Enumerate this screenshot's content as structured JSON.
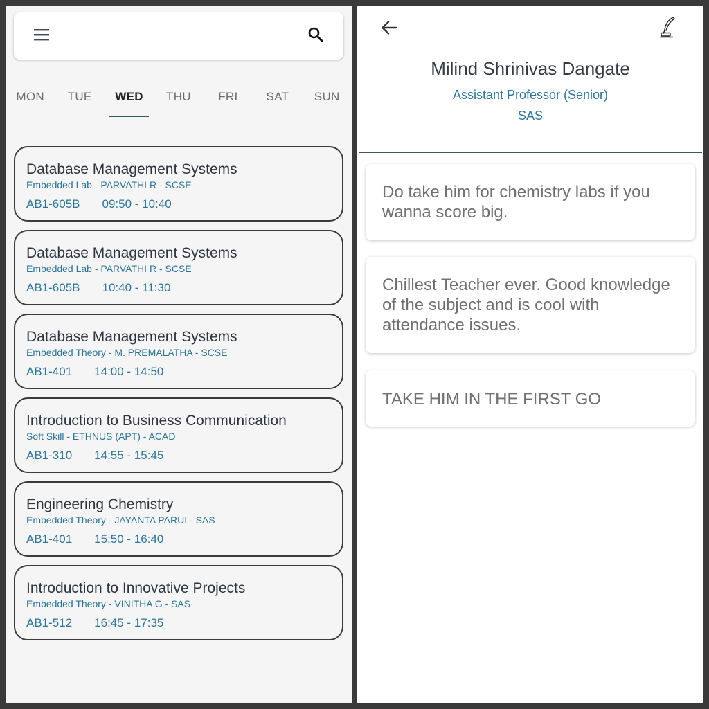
{
  "timetable": {
    "days": [
      {
        "label": "MON",
        "active": false
      },
      {
        "label": "TUE",
        "active": false
      },
      {
        "label": "WED",
        "active": true
      },
      {
        "label": "THU",
        "active": false
      },
      {
        "label": "FRI",
        "active": false
      },
      {
        "label": "SAT",
        "active": false
      },
      {
        "label": "SUN",
        "active": false
      }
    ],
    "classes": [
      {
        "title": "Database Management Systems",
        "subtitle": "Embedded Lab - PARVATHI R - SCSE",
        "room": "AB1-605B",
        "time": "09:50 - 10:40"
      },
      {
        "title": "Database Management Systems",
        "subtitle": "Embedded Lab - PARVATHI R - SCSE",
        "room": "AB1-605B",
        "time": "10:40 - 11:30"
      },
      {
        "title": "Database Management Systems",
        "subtitle": "Embedded Theory - M. PREMALATHA - SCSE",
        "room": "AB1-401",
        "time": "14:00 - 14:50"
      },
      {
        "title": "Introduction to Business Communication",
        "subtitle": "Soft Skill - ETHNUS (APT) - ACAD",
        "room": "AB1-310",
        "time": "14:55 - 15:45"
      },
      {
        "title": "Engineering Chemistry",
        "subtitle": "Embedded Theory - JAYANTA PARUI - SAS",
        "room": "AB1-401",
        "time": "15:50 - 16:40"
      },
      {
        "title": "Introduction to Innovative Projects",
        "subtitle": "Embedded Theory - VINITHA G - SAS",
        "room": "AB1-512",
        "time": "16:45 - 17:35"
      }
    ]
  },
  "professor": {
    "name": "Milind Shrinivas Dangate",
    "designation": "Assistant Professor (Senior)",
    "department": "SAS",
    "reviews": [
      {
        "text": "Do take him for chemistry labs if you wanna score big."
      },
      {
        "text": "Chillest Teacher ever. Good knowledge of the subject and is cool with attendance issues."
      },
      {
        "text": "TAKE HIM IN THE FIRST GO"
      }
    ]
  },
  "icons": {
    "menu": "menu-icon",
    "search": "search-icon",
    "back": "arrow-back-icon",
    "edit": "quill-pen-icon"
  },
  "colors": {
    "accent_blue": "#2d7496",
    "tab_indicator": "#2e5d6e",
    "card_border": "#3b3b3b",
    "panel_bg": "#f5f5f5"
  }
}
